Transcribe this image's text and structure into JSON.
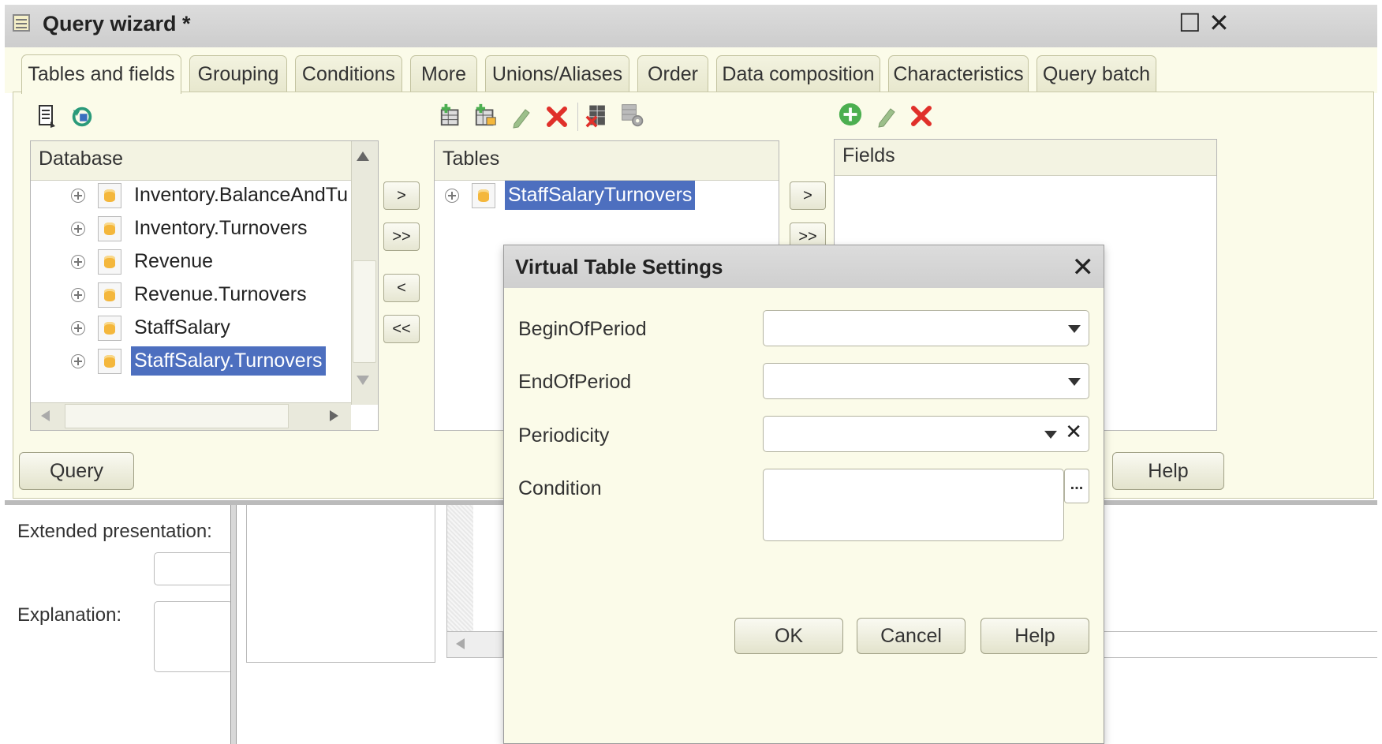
{
  "window": {
    "title": "Query wizard *",
    "maximize_glyph": "☐",
    "close_glyph": "✕"
  },
  "tabs": [
    {
      "label": "Tables and fields",
      "active": true
    },
    {
      "label": "Grouping"
    },
    {
      "label": "Conditions"
    },
    {
      "label": "More"
    },
    {
      "label": "Unions/Aliases"
    },
    {
      "label": "Order"
    },
    {
      "label": "Data composition"
    },
    {
      "label": "Characteristics"
    },
    {
      "label": "Query batch"
    }
  ],
  "database": {
    "header": "Database",
    "items": [
      {
        "label": "Inventory.BalanceAndTurnovers"
      },
      {
        "label": "Inventory.Turnovers"
      },
      {
        "label": "Revenue"
      },
      {
        "label": "Revenue.Turnovers"
      },
      {
        "label": "StaffSalary"
      },
      {
        "label": "StaffSalary.Turnovers",
        "selected": true
      }
    ]
  },
  "tables": {
    "header": "Tables",
    "items": [
      {
        "label": "StaffSalaryTurnovers",
        "selected": true
      }
    ]
  },
  "fields": {
    "header": "Fields"
  },
  "move_buttons": {
    "add_one": ">",
    "add_all": ">>",
    "remove_one": "<",
    "remove_all": "<<"
  },
  "footer": {
    "query_button": "Query",
    "help_button": "Help"
  },
  "lower": {
    "extended_presentation_label": "Extended presentation:",
    "explanation_label": "Explanation:"
  },
  "dialog": {
    "title": "Virtual Table Settings",
    "close_glyph": "✕",
    "fields": {
      "begin_label": "BeginOfPeriod",
      "begin_value": "",
      "end_label": "EndOfPeriod",
      "end_value": "",
      "periodicity_label": "Periodicity",
      "periodicity_value": "",
      "condition_label": "Condition",
      "condition_value": "",
      "ellipsis": "..."
    },
    "buttons": {
      "ok": "OK",
      "cancel": "Cancel",
      "help": "Help"
    }
  },
  "colors": {
    "selection": "#4d6fbf",
    "panel": "#fbfbe9",
    "delete_red": "#e0302a",
    "add_green": "#4caf50"
  }
}
